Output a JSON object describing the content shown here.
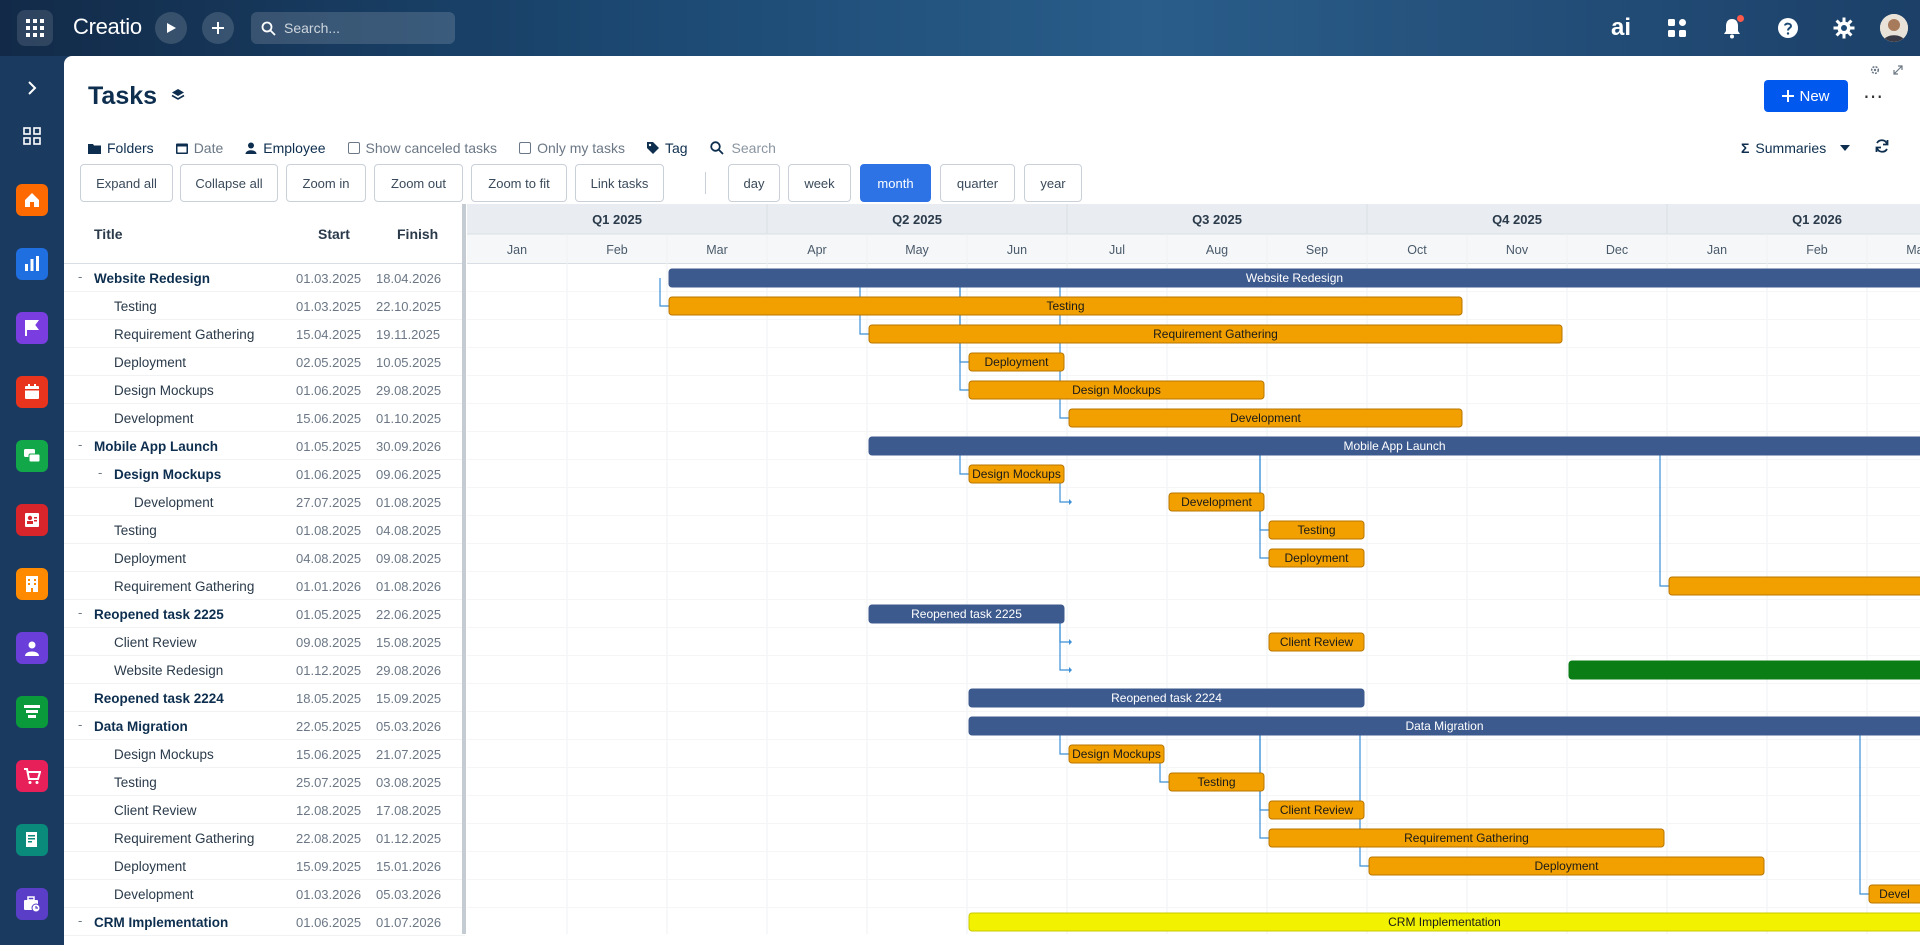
{
  "topbar": {
    "logo": "Creatio",
    "search_placeholder": "Search...",
    "ai_label": "ai"
  },
  "page": {
    "title": "Tasks",
    "new_label": "New",
    "more_label": "⋯"
  },
  "filters": {
    "folders": "Folders",
    "date": "Date",
    "employee": "Employee",
    "show_canceled": "Show canceled tasks",
    "only_my": "Only my tasks",
    "tag": "Tag",
    "search_placeholder": "Search",
    "summaries": "Summaries"
  },
  "toolbar": {
    "expand_all": "Expand all",
    "collapse_all": "Collapse all",
    "zoom_in": "Zoom in",
    "zoom_out": "Zoom out",
    "zoom_to_fit": "Zoom to fit",
    "link_tasks": "Link tasks",
    "day": "day",
    "week": "week",
    "month": "month",
    "quarter": "quarter",
    "year": "year"
  },
  "grid": {
    "headers": {
      "title": "Title",
      "start": "Start",
      "finish": "Finish"
    },
    "rows": [
      {
        "title": "Website Redesign",
        "start": "01.03.2025",
        "finish": "18.04.2026",
        "level": 0,
        "parent": true
      },
      {
        "title": "Testing",
        "start": "01.03.2025",
        "finish": "22.10.2025",
        "level": 1,
        "parent": false
      },
      {
        "title": "Requirement Gathering",
        "start": "15.04.2025",
        "finish": "19.11.2025",
        "level": 1,
        "parent": false
      },
      {
        "title": "Deployment",
        "start": "02.05.2025",
        "finish": "10.05.2025",
        "level": 1,
        "parent": false
      },
      {
        "title": "Design Mockups",
        "start": "01.06.2025",
        "finish": "29.08.2025",
        "level": 1,
        "parent": false
      },
      {
        "title": "Development",
        "start": "15.06.2025",
        "finish": "01.10.2025",
        "level": 1,
        "parent": false
      },
      {
        "title": "Mobile App Launch",
        "start": "01.05.2025",
        "finish": "30.09.2026",
        "level": 0,
        "parent": true
      },
      {
        "title": "Design Mockups",
        "start": "01.06.2025",
        "finish": "09.06.2025",
        "level": 1,
        "parent": true
      },
      {
        "title": "Development",
        "start": "27.07.2025",
        "finish": "01.08.2025",
        "level": 2,
        "parent": false
      },
      {
        "title": "Testing",
        "start": "01.08.2025",
        "finish": "04.08.2025",
        "level": 1,
        "parent": false
      },
      {
        "title": "Deployment",
        "start": "04.08.2025",
        "finish": "09.08.2025",
        "level": 1,
        "parent": false
      },
      {
        "title": "Requirement Gathering",
        "start": "01.01.2026",
        "finish": "01.08.2026",
        "level": 1,
        "parent": false
      },
      {
        "title": "Reopened task 2225",
        "start": "01.05.2025",
        "finish": "22.06.2025",
        "level": 0,
        "parent": true
      },
      {
        "title": "Client Review",
        "start": "09.08.2025",
        "finish": "15.08.2025",
        "level": 1,
        "parent": false
      },
      {
        "title": "Website Redesign",
        "start": "01.12.2025",
        "finish": "29.08.2026",
        "level": 1,
        "parent": false
      },
      {
        "title": "Reopened task 2224",
        "start": "18.05.2025",
        "finish": "15.09.2025",
        "level": 0,
        "parent": false
      },
      {
        "title": "Data Migration",
        "start": "22.05.2025",
        "finish": "05.03.2026",
        "level": 0,
        "parent": true
      },
      {
        "title": "Design Mockups",
        "start": "15.06.2025",
        "finish": "21.07.2025",
        "level": 1,
        "parent": false
      },
      {
        "title": "Testing",
        "start": "25.07.2025",
        "finish": "03.08.2025",
        "level": 1,
        "parent": false
      },
      {
        "title": "Client Review",
        "start": "12.08.2025",
        "finish": "17.08.2025",
        "level": 1,
        "parent": false
      },
      {
        "title": "Requirement Gathering",
        "start": "22.08.2025",
        "finish": "01.12.2025",
        "level": 1,
        "parent": false
      },
      {
        "title": "Deployment",
        "start": "15.09.2025",
        "finish": "15.01.2026",
        "level": 1,
        "parent": false
      },
      {
        "title": "Development",
        "start": "01.03.2026",
        "finish": "05.03.2026",
        "level": 1,
        "parent": false
      },
      {
        "title": "CRM Implementation",
        "start": "01.06.2025",
        "finish": "01.07.2026",
        "level": 0,
        "parent": true
      }
    ]
  },
  "timeline": {
    "quarters": [
      "Q1 2025",
      "Q2 2025",
      "Q3 2025",
      "Q4 2025",
      "Q1 2026"
    ],
    "months": [
      "Jan",
      "Feb",
      "Mar",
      "Apr",
      "May",
      "Jun",
      "Jul",
      "Aug",
      "Sep",
      "Oct",
      "Nov",
      "Dec",
      "Jan",
      "Feb",
      "Mar"
    ],
    "bars": [
      {
        "row": 0,
        "start": 2.0,
        "end": 16.0,
        "label": "Website Redesign",
        "kind": "summary"
      },
      {
        "row": 1,
        "start": 2.0,
        "end": 9.95,
        "label": "Testing",
        "kind": "task"
      },
      {
        "row": 2,
        "start": 4.0,
        "end": 10.95,
        "label": "Requirement Gathering",
        "kind": "task"
      },
      {
        "row": 3,
        "start": 5.0,
        "end": 5.97,
        "label": "Deployment",
        "kind": "task"
      },
      {
        "row": 4,
        "start": 5.0,
        "end": 7.97,
        "label": "Design Mockups",
        "kind": "task"
      },
      {
        "row": 5,
        "start": 6.0,
        "end": 9.95,
        "label": "Development",
        "kind": "task"
      },
      {
        "row": 6,
        "start": 4.0,
        "end": 16.0,
        "label": "Mobile App Launch",
        "kind": "summary"
      },
      {
        "row": 7,
        "start": 5.0,
        "end": 5.97,
        "label": "Design Mockups",
        "kind": "task"
      },
      {
        "row": 8,
        "start": 7.0,
        "end": 7.97,
        "label": "Development",
        "kind": "task"
      },
      {
        "row": 9,
        "start": 8.0,
        "end": 8.97,
        "label": "Testing",
        "kind": "task"
      },
      {
        "row": 10,
        "start": 8.0,
        "end": 8.97,
        "label": "Deployment",
        "kind": "task"
      },
      {
        "row": 11,
        "start": 12.0,
        "end": 16.0,
        "label": "",
        "kind": "task"
      },
      {
        "row": 12,
        "start": 4.0,
        "end": 5.97,
        "label": "Reopened task 2225",
        "kind": "summary"
      },
      {
        "row": 13,
        "start": 8.0,
        "end": 8.97,
        "label": "Client Review",
        "kind": "task"
      },
      {
        "row": 14,
        "start": 11.0,
        "end": 16.0,
        "label": "",
        "kind": "milestone-green"
      },
      {
        "row": 15,
        "start": 5.0,
        "end": 8.97,
        "label": "Reopened task 2224",
        "kind": "summary"
      },
      {
        "row": 16,
        "start": 5.0,
        "end": 16.0,
        "label": "Data Migration",
        "kind": "summary"
      },
      {
        "row": 17,
        "start": 6.0,
        "end": 6.97,
        "label": "Design Mockups",
        "kind": "task"
      },
      {
        "row": 18,
        "start": 7.0,
        "end": 7.97,
        "label": "Testing",
        "kind": "task"
      },
      {
        "row": 19,
        "start": 8.0,
        "end": 8.97,
        "label": "Client Review",
        "kind": "task"
      },
      {
        "row": 20,
        "start": 8.0,
        "end": 11.97,
        "label": "Requirement Gathering",
        "kind": "task"
      },
      {
        "row": 21,
        "start": 9.0,
        "end": 12.97,
        "label": "Deployment",
        "kind": "task"
      },
      {
        "row": 22,
        "start": 14.0,
        "end": 16.0,
        "label": "Devel",
        "kind": "task"
      },
      {
        "row": 23,
        "start": 5.0,
        "end": 16.0,
        "label": "CRM Implementation",
        "kind": "summary-yellow"
      }
    ],
    "links": [
      {
        "from": 0,
        "to": 1,
        "x": 2.0
      },
      {
        "from": 0,
        "to": 2,
        "x": 4.0
      },
      {
        "from": 0,
        "to": 3,
        "x": 5.0
      },
      {
        "from": 0,
        "to": 4,
        "x": 5.0
      },
      {
        "from": 0,
        "to": 5,
        "x": 6.0
      },
      {
        "from": 6,
        "to": 7,
        "x": 5.0
      },
      {
        "from": 7,
        "to": 8,
        "x": 6.0
      },
      {
        "from": 6,
        "to": 9,
        "x": 8.0
      },
      {
        "from": 6,
        "to": 10,
        "x": 8.0
      },
      {
        "from": 6,
        "to": 11,
        "x": 12.0
      },
      {
        "from": 12,
        "to": 13,
        "x": 6.0
      },
      {
        "from": 12,
        "to": 14,
        "x": 6.0
      },
      {
        "from": 16,
        "to": 17,
        "x": 6.0
      },
      {
        "from": 17,
        "to": 18,
        "x": 7.0
      },
      {
        "from": 16,
        "to": 19,
        "x": 8.0
      },
      {
        "from": 16,
        "to": 20,
        "x": 8.0
      },
      {
        "from": 16,
        "to": 21,
        "x": 9.0
      },
      {
        "from": 16,
        "to": 22,
        "x": 14.0
      }
    ]
  },
  "colors": {
    "summary": "#3d5a8e",
    "task": "#f2a000",
    "task_border": "#b87600",
    "green": "#0a7d15",
    "yellow": "#f2f200",
    "link": "#3b8fd8",
    "accent": "#0058ef"
  }
}
